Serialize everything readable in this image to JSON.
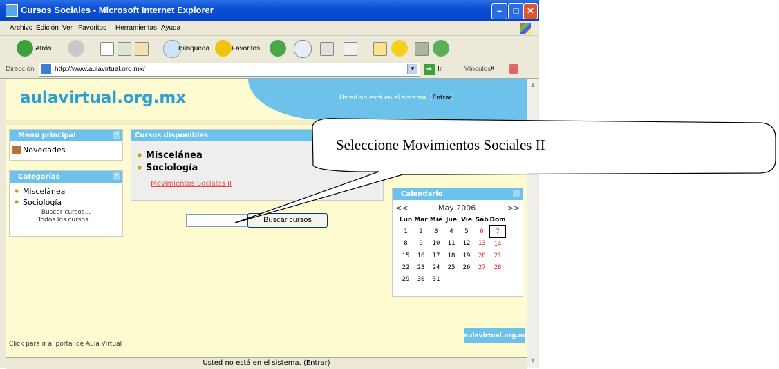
{
  "window": {
    "title": "Cursos Sociales - Microsoft Internet Explorer",
    "buttons": {
      "minimize": "–",
      "maximize": "□",
      "close": "✕"
    }
  },
  "menubar": [
    "Archivo",
    "Edición",
    "Ver",
    "Favoritos",
    "Herramientas",
    "Ayuda"
  ],
  "toolbar": {
    "back": "Atrás",
    "search": "Búsqueda",
    "favorites": "Favoritos"
  },
  "addressbar": {
    "label": "Dirección",
    "url": "http://www.aulavirtual.org.mx/",
    "go": "Ir",
    "links": "Vínculos",
    "more": "»"
  },
  "header": {
    "logo": "aulavirtual.org.mx",
    "login_msg": "Usted no está en el sistema. (",
    "login_link": "Entrar",
    "login_close": ")"
  },
  "menu_principal": {
    "title": "Menú principal",
    "items": [
      "Novedades"
    ]
  },
  "categorias": {
    "title": "Categorías",
    "items": [
      "Miscelánea",
      "Sociología"
    ],
    "links": [
      "Buscar cursos...",
      "Todos los cursos..."
    ]
  },
  "cursos": {
    "title": "Cursos disponibles",
    "categories": [
      "Miscelánea",
      "Sociología"
    ],
    "course_link": "Movimientos Sociales II"
  },
  "search": {
    "button": "Buscar cursos",
    "value": ""
  },
  "calendar": {
    "title": "Calendario",
    "prev": "<<",
    "next": ">>",
    "month": "May 2006",
    "weekdays": [
      "Lun",
      "Mar",
      "Mié",
      "Jue",
      "Vie",
      "Sáb",
      "Dom"
    ],
    "weeks": [
      [
        "1",
        "2",
        "3",
        "4",
        "5",
        "6",
        "7"
      ],
      [
        "8",
        "9",
        "10",
        "11",
        "12",
        "13",
        "14"
      ],
      [
        "15",
        "16",
        "17",
        "18",
        "19",
        "20",
        "21"
      ],
      [
        "22",
        "23",
        "24",
        "25",
        "26",
        "27",
        "28"
      ],
      [
        "29",
        "30",
        "31",
        "",
        "",
        "",
        ""
      ]
    ],
    "today": "7",
    "weekend_color": "#e02020"
  },
  "footer": {
    "link": "Click para ir al portal de Aula Virtual",
    "logo": "aulavirtual.org.mx"
  },
  "status": {
    "text": "Usted no está en el sistema. (Entrar)"
  },
  "callout": {
    "text": "Seleccione Movimientos Sociales II"
  },
  "colors": {
    "accent": "#6cc2ea",
    "page_bg": "#fffbd1",
    "link": "#e04e4e",
    "logo": "#2b9fd6"
  }
}
